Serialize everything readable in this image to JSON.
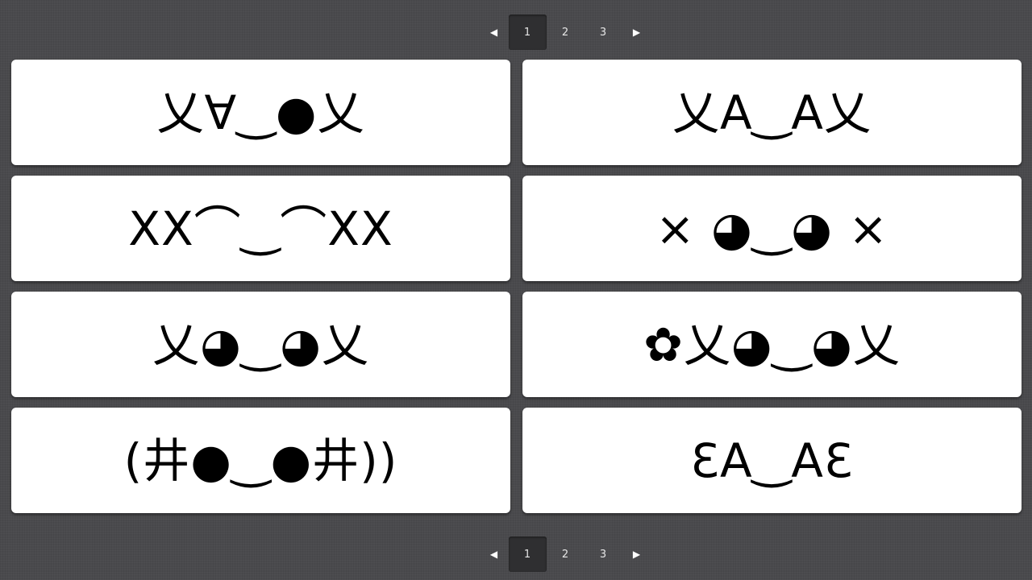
{
  "pagination": {
    "prev_icon": "◀",
    "next_icon": "▶",
    "pages": [
      "1",
      "2",
      "3"
    ],
    "active_page": "1"
  },
  "emoticons": [
    "乂∀‿●乂",
    "乂A‿A乂",
    "XX⌒‿⌒XX",
    "× ◕‿◕ ×",
    "乂◕‿◕乂",
    "✿乂◕‿◕乂",
    "(井●‿●井))",
    "ƐA‿AƐ"
  ]
}
